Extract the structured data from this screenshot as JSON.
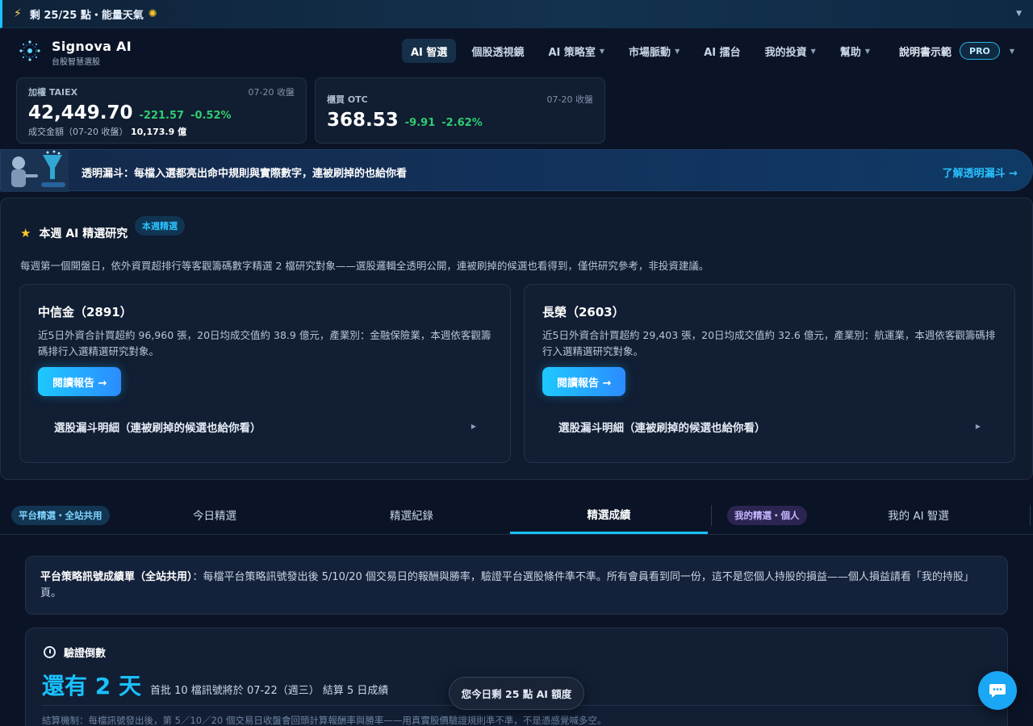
{
  "energy_bar": {
    "text": "剩 25/25 點・能量天氣",
    "icons": [
      "bolt-icon",
      "sun-icon",
      "chevron-down-icon"
    ]
  },
  "header": {
    "brand_name": "Signova AI",
    "brand_sub": "台股智慧選股",
    "nav": [
      {
        "label": "AI 智選",
        "active": true,
        "caret": false
      },
      {
        "label": "個股透視鏡",
        "active": false,
        "caret": false
      },
      {
        "label": "AI 策略室",
        "active": false,
        "caret": true
      },
      {
        "label": "市場脈動",
        "active": false,
        "caret": true
      },
      {
        "label": "AI 擂台",
        "active": false,
        "caret": false
      },
      {
        "label": "我的投資",
        "active": false,
        "caret": true
      },
      {
        "label": "幫助",
        "active": false,
        "caret": true
      }
    ],
    "user_name": "說明書示範",
    "plan_badge": "PRO"
  },
  "indices": [
    {
      "label": "加權 TAIEX",
      "date": "07-20 收盤",
      "price": "42,449.70",
      "change": "-221.57",
      "change_pct": "-0.52%",
      "volume_label": "成交金額（07-20 收盤）",
      "volume": "10,173.9 億"
    },
    {
      "label": "櫃買 OTC",
      "date": "07-20 收盤",
      "price": "368.53",
      "change": "-9.91",
      "change_pct": "-2.62%"
    }
  ],
  "funnel_banner": {
    "text": "透明漏斗：每檔入選都亮出命中規則與實際數字，連被刷掉的也給你看",
    "link": "了解透明漏斗 →"
  },
  "weekly": {
    "title": "本週 AI 精選研究",
    "badge": "本週精選",
    "desc": "每週第一個開盤日，依外資買超排行等客觀籌碼數字精選 2 檔研究對象——選股邏輯全透明公開，連被刷掉的候選也看得到，僅供研究參考，非投資建議。",
    "picks": [
      {
        "name": "中信金（2891）",
        "desc": "近5日外資合計買超約 96,960 張，20日均成交值約 38.9 億元，產業別：金融保險業，本週依客觀籌碼排行入選精選研究對象。",
        "button": "閱讀報告 →",
        "detail": "選股漏斗明細（連被刷掉的候選也給你看）"
      },
      {
        "name": "長榮（2603）",
        "desc": "近5日外資合計買超約 29,403 張，20日均成交值約 32.6 億元，產業別：航運業，本週依客觀籌碼排行入選精選研究對象。",
        "button": "閱讀報告 →",
        "detail": "選股漏斗明細（連被刷掉的候選也給你看）"
      }
    ]
  },
  "tabs": {
    "platform_badge": "平台精選・全站共用",
    "personal_badge": "我的精選・個人",
    "items": [
      {
        "label": "今日精選",
        "active": false
      },
      {
        "label": "精選紀錄",
        "active": false
      },
      {
        "label": "精選成績",
        "active": true
      },
      {
        "label": "我的 AI 智選",
        "active": false
      }
    ]
  },
  "info_panel": {
    "bold": "平台策略訊號成績單（全站共用）",
    "text": "：每檔平台策略訊號發出後 5/10/20 個交易日的報酬與勝率，驗證平台選股條件準不準。所有會員看到同一份，這不是您個人持股的損益——個人損益請看「我的持股」頁。"
  },
  "countdown": {
    "title": "驗證倒數",
    "big": "還有 2 天",
    "desc": "首批 10 檔訊號將於 07-22（週三） 結算 5 日成績",
    "mechanism": "結算機制：每檔訊號發出後，第 5／10／20 個交易日收盤會回頭計算報酬率與勝率——用真實股價驗證規則準不準，不是憑感覺喊多空。"
  },
  "quota_pill": "您今日剩 25 點 AI 額度",
  "colors": {
    "accent": "#19c1ff",
    "up_down": "#2ecc71",
    "background": "#0b1426",
    "star": "#ffc928"
  }
}
